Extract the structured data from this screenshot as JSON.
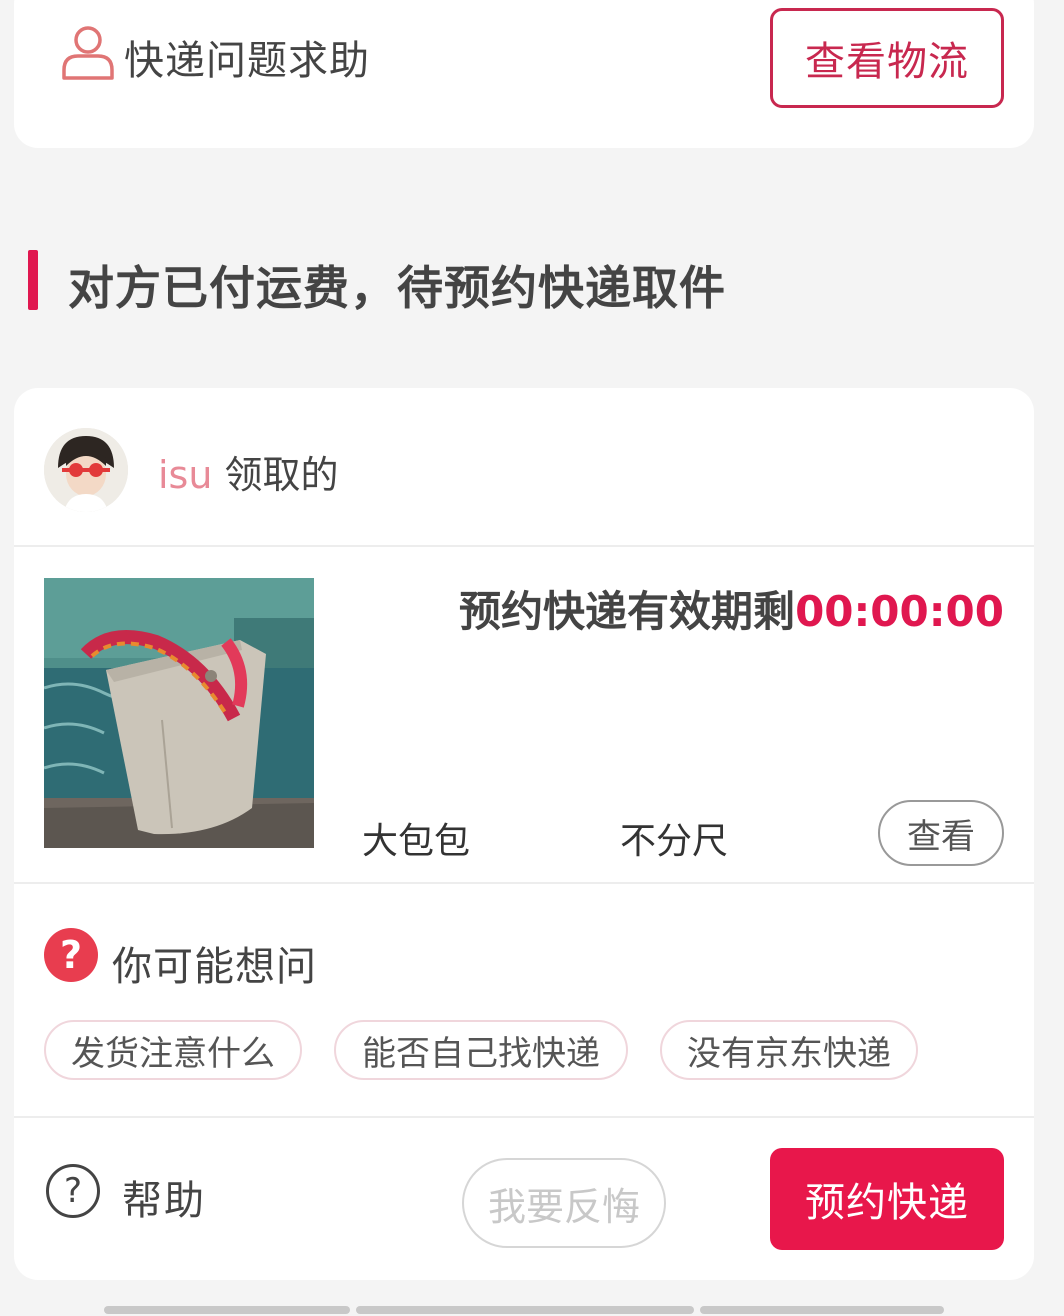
{
  "help_card": {
    "title": "快递问题求助",
    "icon": "person-icon",
    "logistics_button": "查看物流"
  },
  "section": {
    "title": "对方已付运费，待预约快递取件",
    "accent_color": "#e0174f"
  },
  "order": {
    "claimer_name": "isu",
    "claimer_suffix": "领取的",
    "countdown_label": "预约快递有效期剩",
    "countdown_time": "00:00:00",
    "product_name": "大包包",
    "product_size": "不分尺",
    "view_button": "查看"
  },
  "faq": {
    "title": "你可能想问",
    "icon": "question-icon",
    "chips": [
      "发货注意什么",
      "能否自己找快递",
      "没有京东快递"
    ]
  },
  "footer": {
    "help_label": "帮助",
    "help_icon": "help-circle-icon",
    "regret_button": "我要反悔",
    "book_button": "预约快递",
    "primary_color": "#e8174b"
  }
}
